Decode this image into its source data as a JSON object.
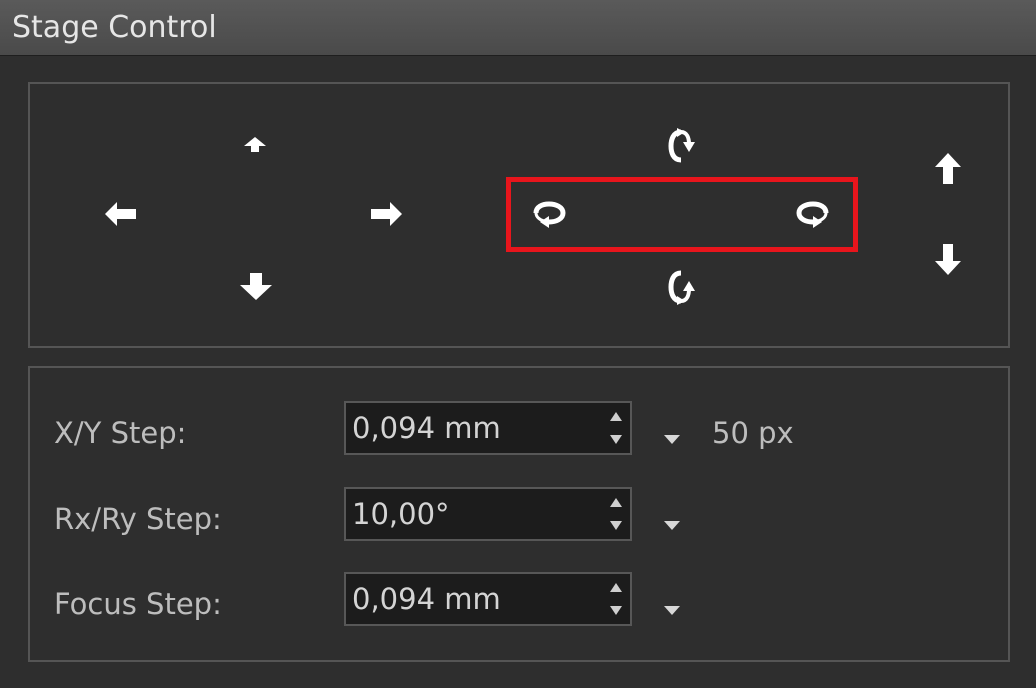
{
  "window": {
    "title": "Stage Control"
  },
  "steps": {
    "xy": {
      "label": "X/Y Step:",
      "value": "0,094 mm",
      "extra": "50 px"
    },
    "rxry": {
      "label": "Rx/Ry Step:",
      "value": "10,00°"
    },
    "focus": {
      "label": "Focus Step:",
      "value": "0,094 mm"
    }
  },
  "colors": {
    "highlight": "#e8151c",
    "arrow": "#ffffff",
    "background": "#2e2e2e"
  },
  "icons": {
    "xy_up": "arrow-up-small-icon",
    "xy_left": "arrow-left-icon",
    "xy_right": "arrow-right-icon",
    "xy_down": "arrow-down-icon",
    "rot_x_up": "rotate-cw-vertical-icon",
    "rot_y_left": "rotate-ccw-horizontal-icon",
    "rot_y_right": "rotate-cw-horizontal-icon",
    "rot_x_down": "rotate-ccw-vertical-icon",
    "focus_up": "arrow-up-icon",
    "focus_down": "arrow-down-icon"
  }
}
